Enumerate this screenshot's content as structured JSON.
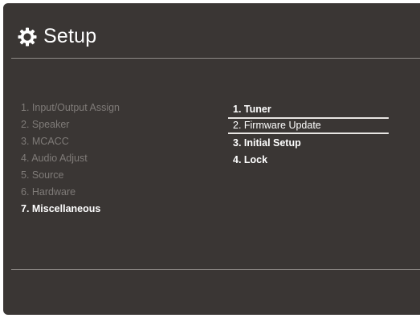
{
  "header": {
    "title": "Setup",
    "icon": "gear-icon"
  },
  "left_menu": {
    "items": [
      {
        "label": "1. Input/Output Assign",
        "active": false
      },
      {
        "label": "2. Speaker",
        "active": false
      },
      {
        "label": "3. MCACC",
        "active": false
      },
      {
        "label": "4. Audio Adjust",
        "active": false
      },
      {
        "label": "5. Source",
        "active": false
      },
      {
        "label": "6. Hardware",
        "active": false
      },
      {
        "label": "7. Miscellaneous",
        "active": true
      }
    ]
  },
  "right_menu": {
    "items": [
      {
        "label": "1. Tuner",
        "selected": false
      },
      {
        "label": "2. Firmware Update",
        "selected": true
      },
      {
        "label": "3. Initial Setup",
        "selected": false
      },
      {
        "label": "4. Lock",
        "selected": false
      }
    ]
  },
  "colors": {
    "background": "#3a3634",
    "text_active": "#ffffff",
    "text_dimmed": "#7f7b78",
    "divider": "#8e8a87",
    "selection": "#e8e6e3"
  }
}
